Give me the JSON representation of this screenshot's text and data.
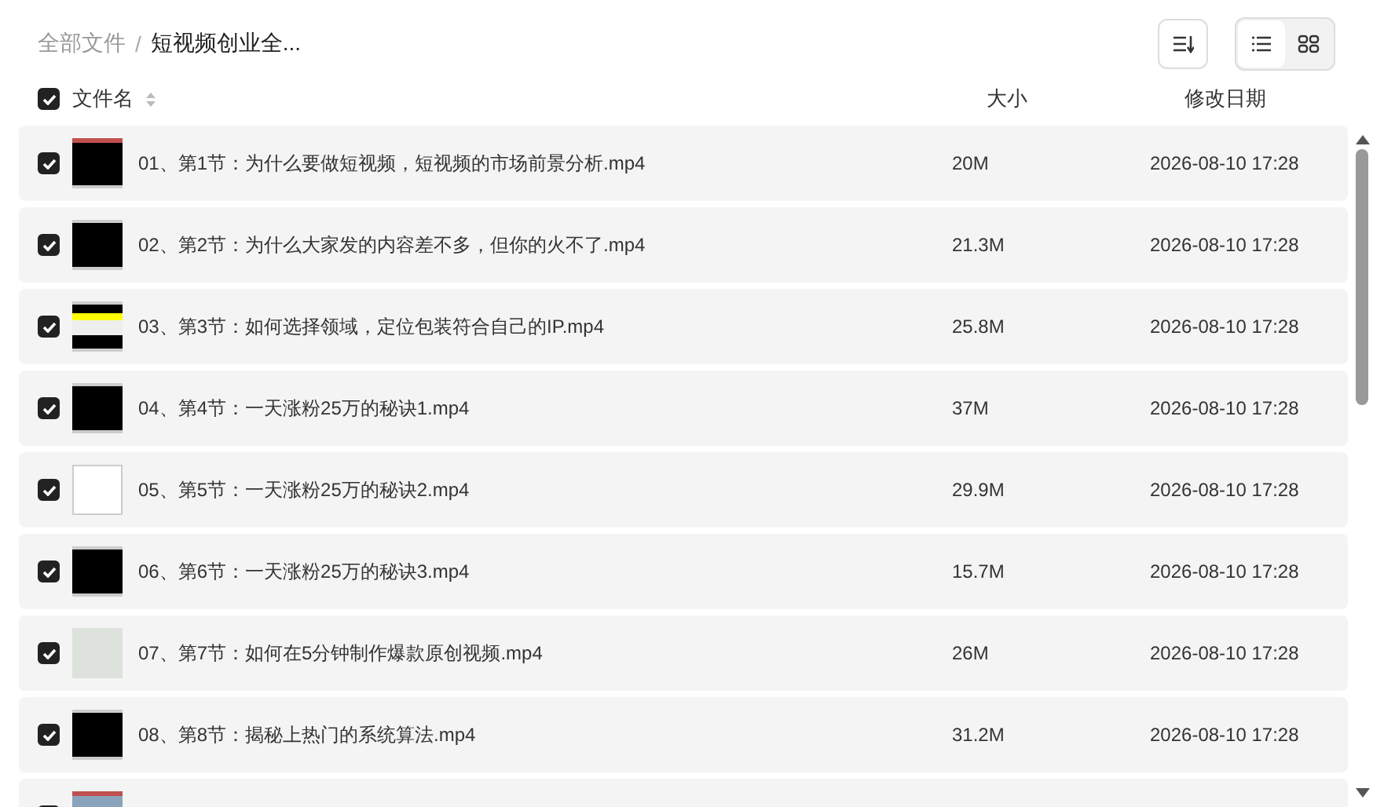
{
  "breadcrumb": {
    "separator": "/",
    "items": [
      {
        "label": "全部文件",
        "current": false
      },
      {
        "label": "短视频创业全...",
        "current": true
      }
    ]
  },
  "view_toggle": [
    {
      "kind": "list",
      "selected": true
    },
    {
      "kind": "grid",
      "selected": false
    }
  ],
  "table": {
    "select_all": {
      "checked": true
    },
    "columns": [
      "文件名",
      "大小",
      "修改日期"
    ],
    "rows": [
      {
        "checked": true,
        "kind": "dark-red",
        "name": "01、第1节：为什么要做短视频，短视频的市场前景分析.mp4",
        "size": "20M",
        "date": "2026-08-10 17:28"
      },
      {
        "checked": true,
        "kind": "dark",
        "name": "02、第2节：为什么大家发的内容差不多，但你的火不了.mp4",
        "size": "21.3M",
        "date": "2026-08-10 17:28"
      },
      {
        "checked": true,
        "kind": "dark-yellow",
        "name": "03、第3节：如何选择领域，定位包装符合自己的IP.mp4",
        "size": "25.8M",
        "date": "2026-08-10 17:28"
      },
      {
        "checked": true,
        "kind": "dark",
        "name": "04、第4节：一天涨粉25万的秘诀1.mp4",
        "size": "37M",
        "date": "2026-08-10 17:28"
      },
      {
        "checked": true,
        "kind": "white",
        "name": "05、第5节：一天涨粉25万的秘诀2.mp4",
        "size": "29.9M",
        "date": "2026-08-10 17:28"
      },
      {
        "checked": true,
        "kind": "dark",
        "name": "06、第6节：一天涨粉25万的秘诀3.mp4",
        "size": "15.7M",
        "date": "2026-08-10 17:28"
      },
      {
        "checked": true,
        "kind": "light",
        "name": "07、第7节：如何在5分钟制作爆款原创视频.mp4",
        "size": "26M",
        "date": "2026-08-10 17:28"
      },
      {
        "checked": true,
        "kind": "dark",
        "name": "08、第8节：揭秘上热门的系统算法.mp4",
        "size": "31.2M",
        "date": "2026-08-10 17:28"
      },
      {
        "checked": true,
        "kind": "blue"
      }
    ]
  }
}
